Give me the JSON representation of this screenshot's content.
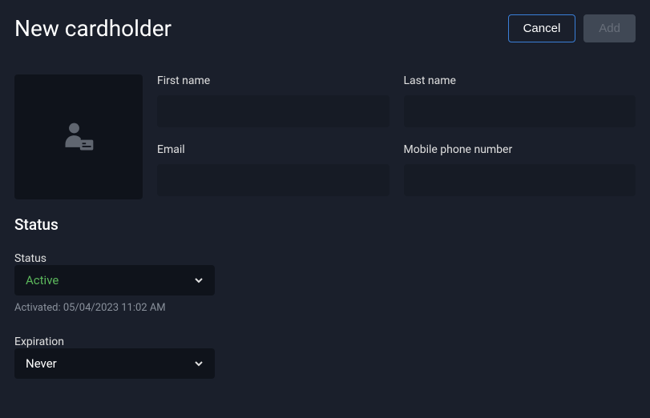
{
  "header": {
    "title": "New cardholder",
    "cancel_label": "Cancel",
    "add_label": "Add"
  },
  "form": {
    "first_name_label": "First name",
    "first_name_value": "",
    "last_name_label": "Last name",
    "last_name_value": "",
    "email_label": "Email",
    "email_value": "",
    "mobile_label": "Mobile phone number",
    "mobile_value": ""
  },
  "status": {
    "section_title": "Status",
    "status_label": "Status",
    "status_value": "Active",
    "activated_text": "Activated: 05/04/2023 11:02 AM",
    "expiration_label": "Expiration",
    "expiration_value": "Never"
  }
}
